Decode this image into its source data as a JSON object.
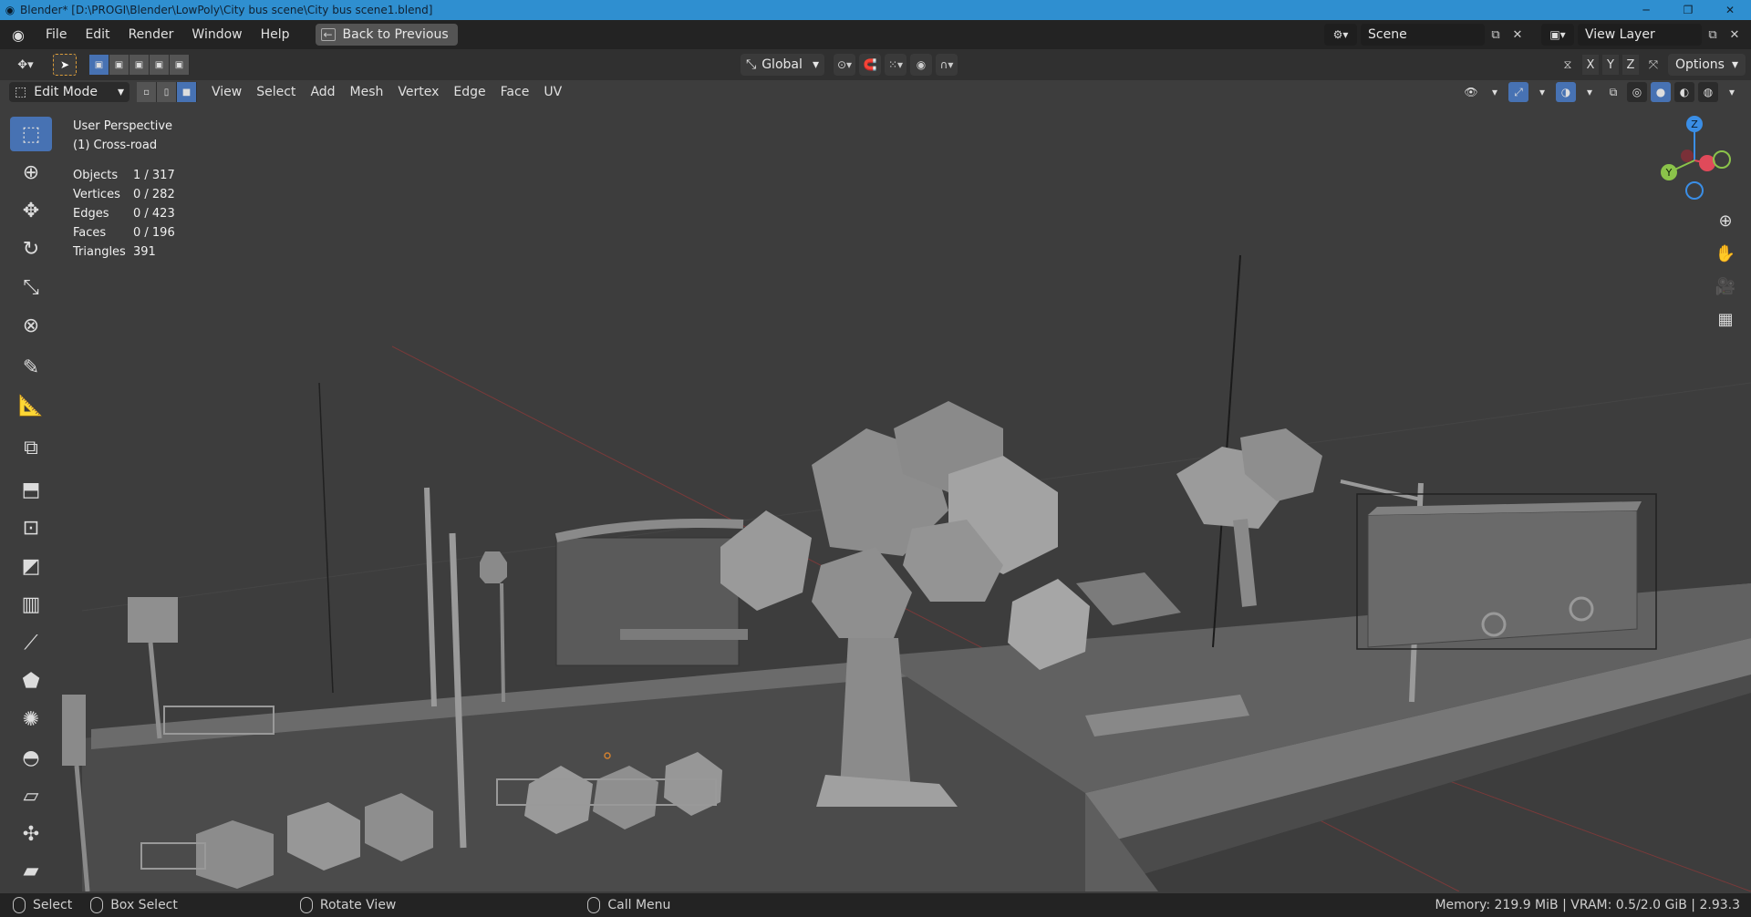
{
  "window": {
    "title": "Blender* [D:\\PROGI\\Blender\\LowPoly\\City bus scene\\City bus scene1.blend]",
    "controls": [
      "─",
      "❐",
      "✕"
    ]
  },
  "menubar": {
    "items": [
      "File",
      "Edit",
      "Render",
      "Window",
      "Help"
    ],
    "back_button": "Back to Previous",
    "scene_name": "Scene",
    "view_layer": "View Layer"
  },
  "header": {
    "transform_orientation": "Global",
    "axes": [
      "X",
      "Y",
      "Z"
    ],
    "options_label": "Options"
  },
  "edit_header": {
    "mode": "Edit Mode",
    "menus": [
      "View",
      "Select",
      "Add",
      "Mesh",
      "Vertex",
      "Edge",
      "Face",
      "UV"
    ]
  },
  "viewport": {
    "perspective": "User Perspective",
    "object_label": "(1) Cross-road",
    "stats": [
      {
        "label": "Objects",
        "value": "1 / 317"
      },
      {
        "label": "Vertices",
        "value": "0 / 282"
      },
      {
        "label": "Edges",
        "value": "0 / 423"
      },
      {
        "label": "Faces",
        "value": "0 / 196"
      },
      {
        "label": "Triangles",
        "value": "391"
      }
    ],
    "gizmo_axes": {
      "z": "Z",
      "y": "Y",
      "x": "X"
    }
  },
  "toolbar": {
    "tools": [
      "select-box-icon",
      "cursor-icon",
      "move-icon",
      "rotate-icon",
      "scale-icon",
      "transform-icon",
      "annotate-icon",
      "measure-icon",
      "add-cube-icon",
      "extrude-icon",
      "inset-icon",
      "bevel-icon",
      "loop-cut-icon",
      "knife-icon",
      "poly-build-icon",
      "spin-icon",
      "smooth-icon",
      "edge-slide-icon",
      "shrink-fatten-icon",
      "shear-icon"
    ]
  },
  "statusbar": {
    "select": "Select",
    "box_select": "Box Select",
    "rotate_view": "Rotate View",
    "call_menu": "Call Menu",
    "memory": "Memory: 219.9 MiB | VRAM: 0.5/2.0 GiB | 2.93.3"
  },
  "colors": {
    "accent": "#4772b3",
    "titlebar": "#2f8fd0",
    "axis_x": "#e04a5a",
    "axis_y": "#8bc34a",
    "axis_z": "#3a8ee6"
  }
}
